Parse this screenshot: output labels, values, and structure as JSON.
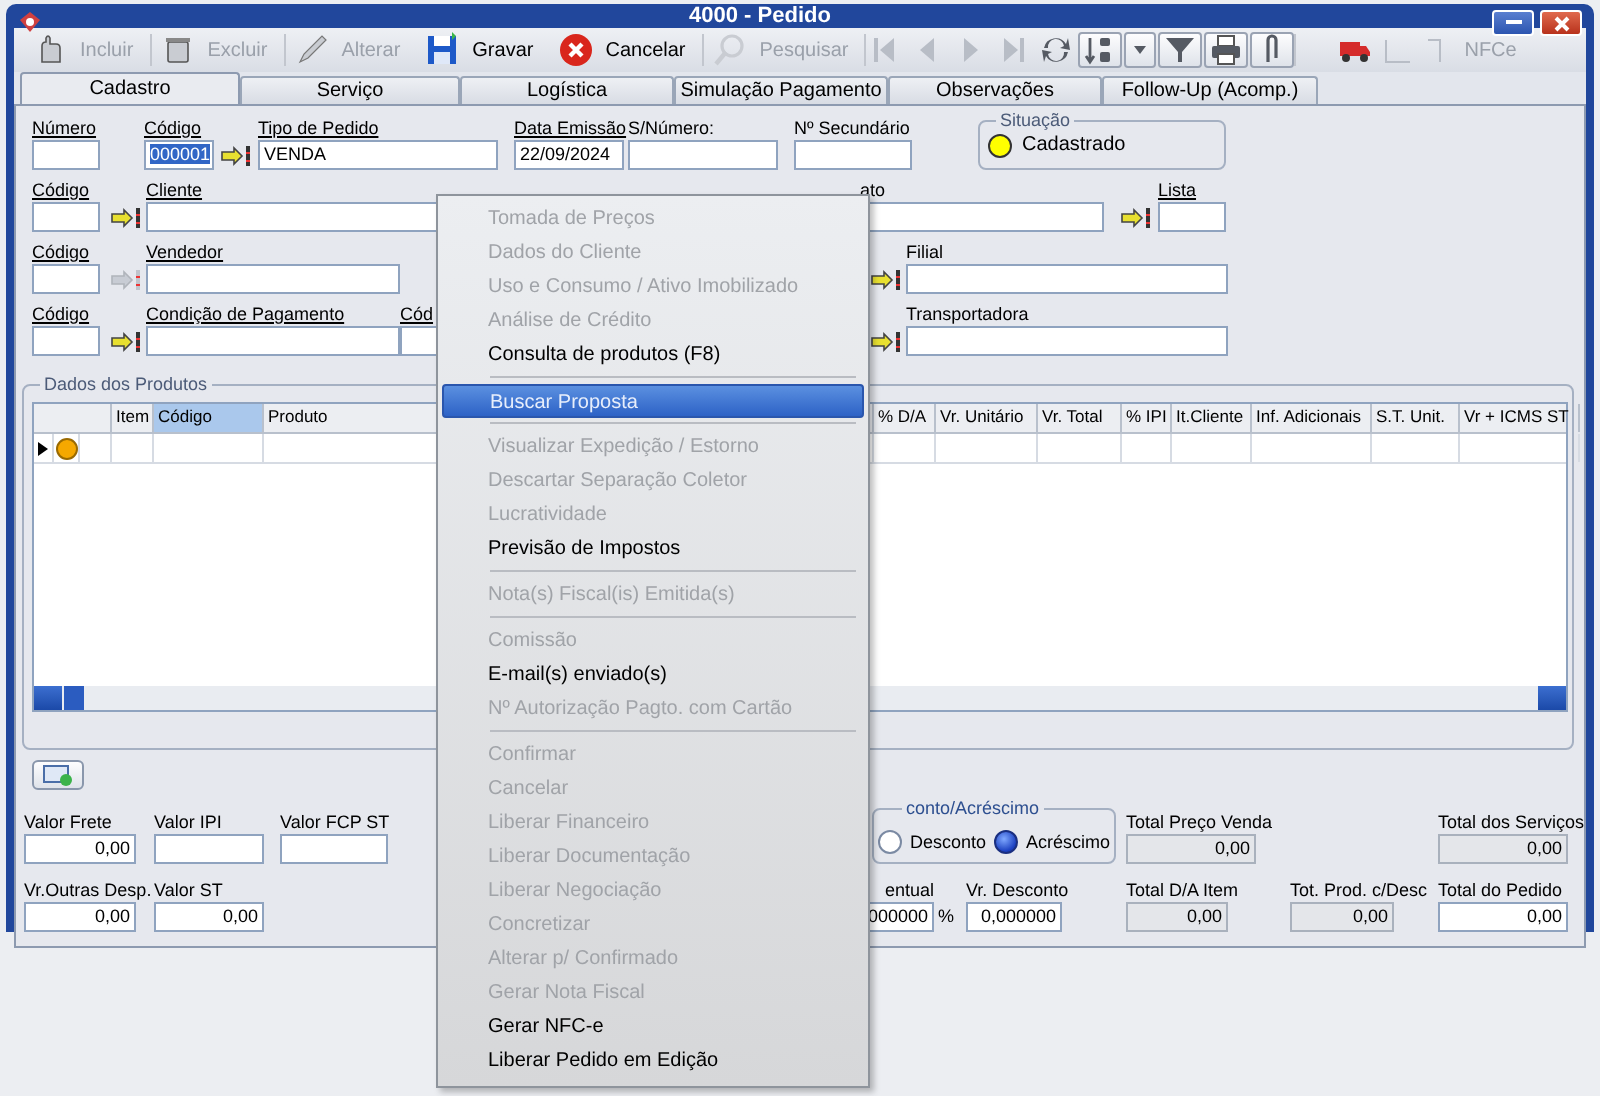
{
  "window": {
    "title": "4000 - Pedido"
  },
  "toolbar": {
    "buttons": [
      {
        "label": "Incluir",
        "disabled": true
      },
      {
        "label": "Excluir",
        "disabled": true
      },
      {
        "label": "Alterar",
        "disabled": true
      },
      {
        "label": "Gravar",
        "disabled": false
      },
      {
        "label": "Cancelar",
        "disabled": false
      },
      {
        "label": "Pesquisar",
        "disabled": true
      }
    ],
    "icon_buttons": [
      {
        "disabled": true
      },
      {
        "disabled": true
      },
      {
        "disabled": true
      },
      {
        "disabled": true
      },
      {
        "disabled": false
      },
      {
        "disabled": false
      },
      {
        "disabled": false
      },
      {
        "disabled": false
      },
      {
        "disabled": false
      },
      {
        "disabled": false
      },
      {
        "disabled": false
      },
      {
        "disabled": true
      },
      {
        "disabled": true
      }
    ],
    "nfce": {
      "label": "NFCe",
      "disabled": true
    }
  },
  "tabs": [
    {
      "label": "Cadastro",
      "selected": true
    },
    {
      "label": "Serviço",
      "selected": false
    },
    {
      "label": "Logística",
      "selected": false
    },
    {
      "label": "Simulação Pagamento",
      "selected": false
    },
    {
      "label": "Observações",
      "selected": false
    },
    {
      "label": "Follow-Up (Acomp.)",
      "selected": false
    }
  ],
  "form": {
    "fields": [
      {
        "kind": "field",
        "label": "Número",
        "required": true
      },
      {
        "kind": "field",
        "label": "Código",
        "required": true,
        "value": "000001",
        "highlighted": true
      },
      {
        "kind": "lookup",
        "disabled": false
      },
      {
        "kind": "field",
        "label": "Tipo de Pedido",
        "required": true,
        "value": "VENDA"
      },
      {
        "kind": "field",
        "label": "Data Emissão",
        "required": true,
        "value": "22/09/2024"
      },
      {
        "kind": "field",
        "label": "S/Número:",
        "required": false
      },
      {
        "kind": "field",
        "label": "Nº Secundário",
        "required": false
      },
      {
        "kind": "status",
        "label": "Situação",
        "value": "Cadastrado",
        "color": "#ffff00"
      },
      {
        "kind": "field",
        "label": "Código",
        "required": true
      },
      {
        "kind": "lookup",
        "disabled": false
      },
      {
        "kind": "field",
        "label": "Cliente",
        "required": true
      },
      {
        "kind": "field",
        "label": "ato",
        "required": false
      },
      {
        "kind": "lookup",
        "disabled": false
      },
      {
        "kind": "field",
        "label": "Lista",
        "required": true
      },
      {
        "kind": "field",
        "label": "Código",
        "required": true
      },
      {
        "kind": "lookup",
        "disabled": true
      },
      {
        "kind": "field",
        "label": "Vendedor",
        "required": true
      },
      {
        "kind": "lookup",
        "disabled": false
      },
      {
        "kind": "field",
        "label": "Filial",
        "required": false
      },
      {
        "kind": "field",
        "label": "Código",
        "required": true
      },
      {
        "kind": "lookup",
        "disabled": false
      },
      {
        "kind": "field",
        "label": "Condição de Pagamento",
        "required": true
      },
      {
        "kind": "field",
        "label": "Cód",
        "required": true
      },
      {
        "kind": "lookup",
        "disabled": false
      },
      {
        "kind": "field",
        "label": "Transportadora",
        "required": false
      }
    ]
  },
  "products": {
    "title": "Dados dos Produtos",
    "columns": [
      {
        "label": "Item",
        "selected": false
      },
      {
        "label": "Código",
        "selected": true
      },
      {
        "label": "Produto",
        "selected": false
      },
      {
        "label": "% D/A",
        "selected": false
      },
      {
        "label": "Vr. Unitário",
        "selected": false
      },
      {
        "label": "Vr. Total",
        "selected": false
      },
      {
        "label": "% IPI",
        "selected": false
      },
      {
        "label": "It.Cliente",
        "selected": false
      },
      {
        "label": "Inf. Adicionais",
        "selected": false
      },
      {
        "label": "S.T. Unit.",
        "selected": false
      },
      {
        "label": "Vr + ICMS ST",
        "selected": false
      }
    ],
    "rows": [
      {
        "current": true,
        "color": "#f5a800"
      }
    ]
  },
  "totals": {
    "fields": [
      {
        "kind": "field",
        "label": "Valor Frete",
        "value": "0,00",
        "readonly": false
      },
      {
        "kind": "field",
        "label": "Valor IPI",
        "readonly": false
      },
      {
        "kind": "field",
        "label": "Valor FCP ST",
        "readonly": false
      },
      {
        "kind": "radios",
        "label": "conto/Acréscimo",
        "options": [
          {
            "label": "Desconto",
            "selected": false
          },
          {
            "label": "Acréscimo",
            "selected": true
          }
        ]
      },
      {
        "kind": "field",
        "label": "Total Preço Venda",
        "value": "0,00",
        "readonly": true
      },
      {
        "kind": "field",
        "label": "Total dos Serviços",
        "value": "0,00",
        "readonly": true
      },
      {
        "kind": "field",
        "label": "Vr.Outras Desp.",
        "value": "0,00",
        "readonly": false
      },
      {
        "kind": "field",
        "label": "Valor ST",
        "value": "0,00",
        "readonly": false
      },
      {
        "kind": "field",
        "label": "entual",
        "value": "000000",
        "readonly": false
      },
      {
        "kind": "text",
        "label": "%"
      },
      {
        "kind": "field",
        "label": "Vr. Desconto",
        "value": "0,000000",
        "readonly": false
      },
      {
        "kind": "field",
        "label": "Total D/A Item",
        "value": "0,00",
        "readonly": true
      },
      {
        "kind": "field",
        "label": "Tot. Prod. c/Desc",
        "value": "0,00",
        "readonly": true
      },
      {
        "kind": "field",
        "label": "Total do Pedido",
        "value": "0,00",
        "readonly": false
      }
    ]
  },
  "context_menu": [
    {
      "kind": "item",
      "label": "Tomada de Preços",
      "disabled": true,
      "selected": false
    },
    {
      "kind": "item",
      "label": "Dados do Cliente",
      "disabled": true,
      "selected": false
    },
    {
      "kind": "item",
      "label": "Uso e Consumo / Ativo Imobilizado",
      "disabled": true,
      "selected": false
    },
    {
      "kind": "item",
      "label": "Análise de Crédito",
      "disabled": true,
      "selected": false
    },
    {
      "kind": "item",
      "label": "Consulta de produtos (F8)",
      "disabled": false,
      "selected": false
    },
    {
      "kind": "separator"
    },
    {
      "kind": "item",
      "label": "Buscar Proposta",
      "disabled": false,
      "selected": true
    },
    {
      "kind": "separator"
    },
    {
      "kind": "item",
      "label": "Visualizar Expedição / Estorno",
      "disabled": true,
      "selected": false
    },
    {
      "kind": "item",
      "label": "Descartar Separação Coletor",
      "disabled": true,
      "selected": false
    },
    {
      "kind": "item",
      "label": "Lucratividade",
      "disabled": true,
      "selected": false
    },
    {
      "kind": "item",
      "label": "Previsão de Impostos",
      "disabled": false,
      "selected": false
    },
    {
      "kind": "separator"
    },
    {
      "kind": "item",
      "label": "Nota(s) Fiscal(is) Emitida(s)",
      "disabled": true,
      "selected": false
    },
    {
      "kind": "separator"
    },
    {
      "kind": "item",
      "label": "Comissão",
      "disabled": true,
      "selected": false
    },
    {
      "kind": "item",
      "label": "E-mail(s) enviado(s)",
      "disabled": false,
      "selected": false
    },
    {
      "kind": "item",
      "label": "Nº Autorização Pagto. com Cartão",
      "disabled": true,
      "selected": false
    },
    {
      "kind": "separator"
    },
    {
      "kind": "item",
      "label": "Confirmar",
      "disabled": true,
      "selected": false
    },
    {
      "kind": "item",
      "label": "Cancelar",
      "disabled": true,
      "selected": false
    },
    {
      "kind": "item",
      "label": "Liberar Financeiro",
      "disabled": true,
      "selected": false
    },
    {
      "kind": "item",
      "label": "Liberar Documentação",
      "disabled": true,
      "selected": false
    },
    {
      "kind": "item",
      "label": "Liberar Negociação",
      "disabled": true,
      "selected": false
    },
    {
      "kind": "item",
      "label": "Concretizar",
      "disabled": true,
      "selected": false
    },
    {
      "kind": "item",
      "label": "Alterar p/ Confirmado",
      "disabled": true,
      "selected": false
    },
    {
      "kind": "item",
      "label": "Gerar Nota Fiscal",
      "disabled": true,
      "selected": false
    },
    {
      "kind": "item",
      "label": "Gerar NFC-e",
      "disabled": false,
      "selected": false
    },
    {
      "kind": "item",
      "label": "Liberar Pedido em Edição",
      "disabled": false,
      "selected": false
    }
  ]
}
